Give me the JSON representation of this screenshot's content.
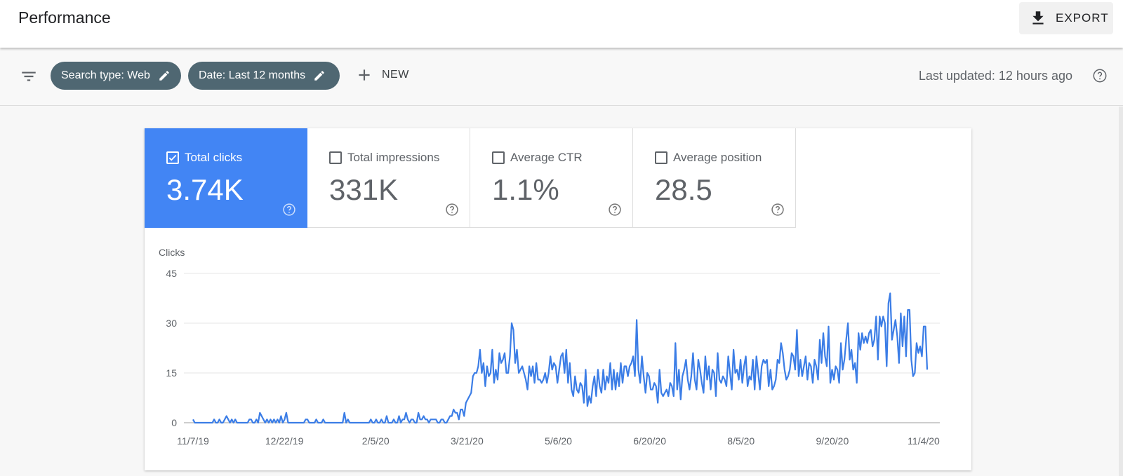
{
  "header": {
    "title": "Performance",
    "export_label": "EXPORT"
  },
  "filters": {
    "chips": [
      {
        "label": "Search type: Web"
      },
      {
        "label": "Date: Last 12 months"
      }
    ],
    "new_label": "NEW",
    "last_updated": "Last updated: 12 hours ago"
  },
  "metrics": [
    {
      "label": "Total clicks",
      "value": "3.74K",
      "selected": true
    },
    {
      "label": "Total impressions",
      "value": "331K",
      "selected": false
    },
    {
      "label": "Average CTR",
      "value": "1.1%",
      "selected": false
    },
    {
      "label": "Average position",
      "value": "28.5",
      "selected": false
    }
  ],
  "colors": {
    "accent": "#4285f4",
    "chip": "#4f6772",
    "line": "#3b7de6"
  },
  "icons": [
    "filter-icon",
    "download-icon",
    "pencil-icon",
    "plus-icon",
    "help-icon",
    "checkbox-checked-icon",
    "checkbox-icon"
  ],
  "chart_data": {
    "type": "line",
    "ylabel": "Clicks",
    "ylim": [
      0,
      45
    ],
    "yticks": [
      "0",
      "15",
      "30",
      "45"
    ],
    "xtick_labels": [
      "11/7/19",
      "12/22/19",
      "2/5/20",
      "3/21/20",
      "5/6/20",
      "6/20/20",
      "8/5/20",
      "9/20/20",
      "11/4/20"
    ],
    "grid": true,
    "series": [
      {
        "values": [
          1,
          0,
          0,
          0,
          0,
          0,
          0,
          0,
          0,
          0,
          0,
          0,
          1,
          0,
          0,
          1,
          0,
          0,
          1,
          2,
          1,
          0,
          1,
          0,
          1,
          0,
          0,
          0,
          0,
          0,
          0,
          0,
          1,
          1,
          0,
          0,
          1,
          0,
          3,
          2,
          1,
          0,
          1,
          0,
          1,
          0,
          1,
          0,
          1,
          0,
          2,
          0,
          1,
          3,
          0,
          0,
          0,
          0,
          0,
          0,
          0,
          0,
          0,
          0,
          1,
          1,
          0,
          0,
          0,
          0,
          1,
          0,
          0,
          0,
          1,
          0,
          0,
          0,
          0,
          0,
          0,
          0,
          0,
          0,
          0,
          0,
          3,
          0,
          1,
          0,
          0,
          0,
          0,
          0,
          0,
          0,
          0,
          0,
          0,
          0,
          0,
          1,
          0,
          0,
          1,
          0,
          0,
          1,
          0,
          0,
          2,
          0,
          0,
          0,
          1,
          0,
          0,
          2,
          0,
          1,
          1,
          3,
          1,
          0,
          1,
          1,
          0,
          0,
          3,
          1,
          1,
          2,
          1,
          1,
          0,
          1,
          1,
          1,
          1,
          0,
          0,
          1,
          1,
          0,
          0,
          1,
          2,
          2,
          4,
          3,
          3,
          1,
          4,
          4,
          2,
          6,
          7,
          8,
          9,
          14,
          15,
          15,
          17,
          22,
          15,
          18,
          11,
          17,
          14,
          15,
          22,
          12,
          16,
          13,
          21,
          18,
          19,
          21,
          15,
          15,
          20,
          30,
          28,
          18,
          22,
          15,
          16,
          17,
          15,
          13,
          10,
          17,
          14,
          17,
          12,
          18,
          13,
          13,
          12,
          13,
          15,
          12,
          15,
          20,
          16,
          18,
          17,
          12,
          16,
          20,
          21,
          15,
          22,
          12,
          18,
          10,
          8,
          14,
          10,
          9,
          12,
          11,
          6,
          16,
          5,
          8,
          6,
          11,
          14,
          8,
          16,
          11,
          9,
          16,
          10,
          14,
          12,
          18,
          10,
          16,
          10,
          15,
          11,
          18,
          12,
          17,
          17,
          14,
          17,
          18,
          20,
          14,
          31,
          16,
          12,
          20,
          14,
          9,
          15,
          14,
          10,
          10,
          12,
          11,
          6,
          16,
          9,
          8,
          9,
          10,
          8,
          12,
          11,
          8,
          24,
          10,
          16,
          7,
          14,
          16,
          19,
          13,
          10,
          14,
          21,
          13,
          10,
          19,
          16,
          12,
          9,
          20,
          13,
          17,
          10,
          16,
          15,
          8,
          21,
          13,
          12,
          14,
          13,
          11,
          20,
          15,
          10,
          22,
          15,
          16,
          13,
          19,
          12,
          17,
          20,
          11,
          14,
          13,
          19,
          10,
          20,
          15,
          10,
          17,
          19,
          18,
          19,
          11,
          16,
          10,
          11,
          13,
          19,
          18,
          24,
          21,
          16,
          13,
          14,
          16,
          21,
          20,
          16,
          28,
          14,
          19,
          14,
          17,
          20,
          13,
          18,
          17,
          12,
          19,
          17,
          13,
          25,
          18,
          27,
          20,
          17,
          29,
          12,
          16,
          13,
          17,
          16,
          12,
          24,
          16,
          19,
          25,
          30,
          19,
          22,
          16,
          18,
          12,
          27,
          22,
          27,
          24,
          26,
          24,
          27,
          28,
          23,
          25,
          32,
          19,
          32,
          29,
          32,
          30,
          17,
          36,
          39,
          25,
          28,
          31,
          26,
          18,
          33,
          23,
          32,
          20,
          34,
          34,
          19,
          14,
          15,
          24,
          21,
          23,
          20,
          29,
          29,
          16
        ]
      }
    ]
  }
}
